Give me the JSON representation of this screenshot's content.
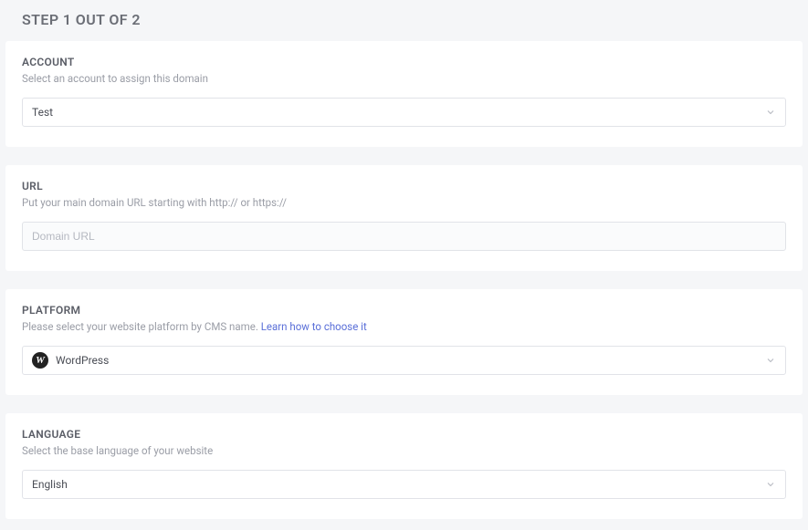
{
  "page": {
    "title": "STEP 1 OUT OF 2"
  },
  "account": {
    "title": "ACCOUNT",
    "desc": "Select an account to assign this domain",
    "selected": "Test"
  },
  "url": {
    "title": "URL",
    "desc": "Put your main domain URL starting with http:// or https://",
    "placeholder": "Domain URL",
    "value": ""
  },
  "platform": {
    "title": "PLATFORM",
    "desc_prefix": "Please select your website platform by CMS name. ",
    "link_text": "Learn how to choose it",
    "selected": "WordPress",
    "icon": "wordpress-icon"
  },
  "language": {
    "title": "LANGUAGE",
    "desc": "Select the base language of your website",
    "selected": "English"
  }
}
